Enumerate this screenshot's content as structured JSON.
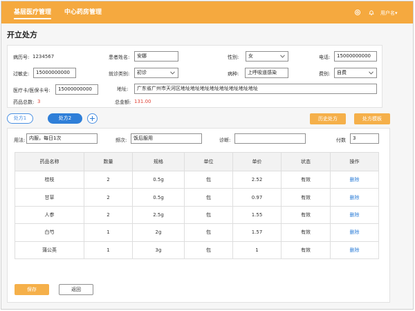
{
  "nav": {
    "tabs": [
      {
        "label": "基层医疗管理",
        "active": true
      },
      {
        "label": "中心药房管理",
        "active": false
      }
    ],
    "user_menu": "用户名▾",
    "icons": [
      "settings-icon",
      "bell-icon"
    ],
    "accent": "#f5a93f"
  },
  "page": {
    "title": "开立处方"
  },
  "patient": {
    "record_no_label": "病历号:",
    "record_no": "1234567",
    "name_label": "患者姓名:",
    "name": "安娜",
    "gender_label": "性别:",
    "gender": "女",
    "phone_label": "电话:",
    "phone": "15000000000",
    "allergy_label": "过敏史:",
    "allergy": "15000000000",
    "visit_type_label": "就诊类别:",
    "visit_type": "初诊",
    "disease_label": "病种:",
    "disease": "上呼吸道感染",
    "fee_type_label": "费别:",
    "fee_type": "自费",
    "card_label": "医疗卡/医保卡号:",
    "card": "15000000000",
    "address_label": "地址:",
    "address": "广东省广州市天河区地址地址地址地址地址地址地址地址",
    "total_count_label": "药品总数:",
    "total_count": "3",
    "total_amount_label": "总金额:",
    "total_amount": "131.00"
  },
  "rx_tabs": [
    {
      "label": "处方1",
      "active": false
    },
    {
      "label": "处方2",
      "active": true
    }
  ],
  "actions": {
    "history": "历史处方",
    "template": "处方模板",
    "save": "保存",
    "back": "返回"
  },
  "rx": {
    "usage_label": "用法:",
    "usage": "内服，每日1次",
    "frequency_label": "频次:",
    "frequency": "饭后服用",
    "diagnosis_label": "诊断:",
    "diagnosis": "",
    "doses_label": "付数",
    "doses": "3"
  },
  "table": {
    "headers": [
      "药品名称",
      "数量",
      "规格",
      "单位",
      "单价",
      "状态",
      "操作"
    ],
    "rows": [
      {
        "name": "桂枝",
        "qty": "2",
        "spec": "0.5g",
        "unit": "包",
        "price": "2.52",
        "status": "有效",
        "op": "删除"
      },
      {
        "name": "甘草",
        "qty": "2",
        "spec": "0.5g",
        "unit": "包",
        "price": "0.97",
        "status": "有效",
        "op": "删除"
      },
      {
        "name": "人参",
        "qty": "2",
        "spec": "2.5g",
        "unit": "包",
        "price": "1.55",
        "status": "有效",
        "op": "删除"
      },
      {
        "name": "白芍",
        "qty": "1",
        "spec": "2g",
        "unit": "包",
        "price": "1.57",
        "status": "有效",
        "op": "删除"
      },
      {
        "name": "蒲公英",
        "qty": "1",
        "spec": "3g",
        "unit": "包",
        "price": "1",
        "status": "有效",
        "op": "删除"
      }
    ]
  }
}
